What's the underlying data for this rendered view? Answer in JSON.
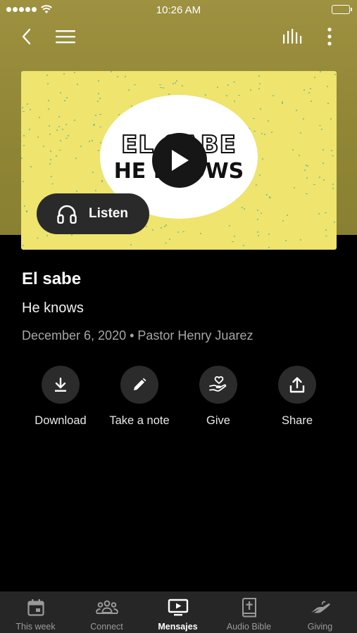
{
  "status_bar": {
    "time": "10:26 AM"
  },
  "message": {
    "artwork_line1": "EL SABE",
    "artwork_line2": "HE KNOWS",
    "listen_label": "Listen",
    "title": "El sabe",
    "subtitle": "He knows",
    "meta": "December 6, 2020 • Pastor Henry Juarez"
  },
  "actions": [
    {
      "label": "Download",
      "icon": "download-icon"
    },
    {
      "label": "Take a note",
      "icon": "pencil-icon"
    },
    {
      "label": "Give",
      "icon": "give-heart-hand-icon"
    },
    {
      "label": "Share",
      "icon": "share-icon"
    }
  ],
  "tabs": [
    {
      "label": "This week",
      "icon": "calendar-icon",
      "active": false
    },
    {
      "label": "Connect",
      "icon": "people-icon",
      "active": false
    },
    {
      "label": "Mensajes",
      "icon": "tv-play-icon",
      "active": true
    },
    {
      "label": "Audio Bible",
      "icon": "bible-icon",
      "active": false
    },
    {
      "label": "Giving",
      "icon": "giving-hand-icon",
      "active": false
    }
  ],
  "colors": {
    "header_gradient": "#9e9140",
    "artwork_background": "#eee46e",
    "background": "#000000",
    "tabbar": "#262626",
    "action_circle": "#2b2b2b"
  }
}
